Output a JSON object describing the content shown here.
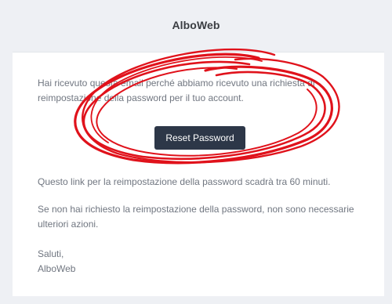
{
  "email": {
    "brand": "AlboWeb",
    "intro": "Hai ricevuto questa email perché abbiamo ricevuto una richiesta di reimpostazione della password per il tuo account.",
    "button_label": "Reset Password",
    "expiry_note": "Questo link per la reimpostazione della password scadrà tra 60 minuti.",
    "no_action_note": "Se non hai richiesto la reimpostazione della password, non sono necessarie ulteriori azioni.",
    "closing": "Saluti,",
    "signature": "AlboWeb"
  },
  "colors": {
    "background": "#eef0f4",
    "card": "#ffffff",
    "button": "#2d3748",
    "text": "#707680",
    "annotation": "#e0121b"
  },
  "annotation": {
    "type": "hand-drawn red circle around intro text and button"
  }
}
